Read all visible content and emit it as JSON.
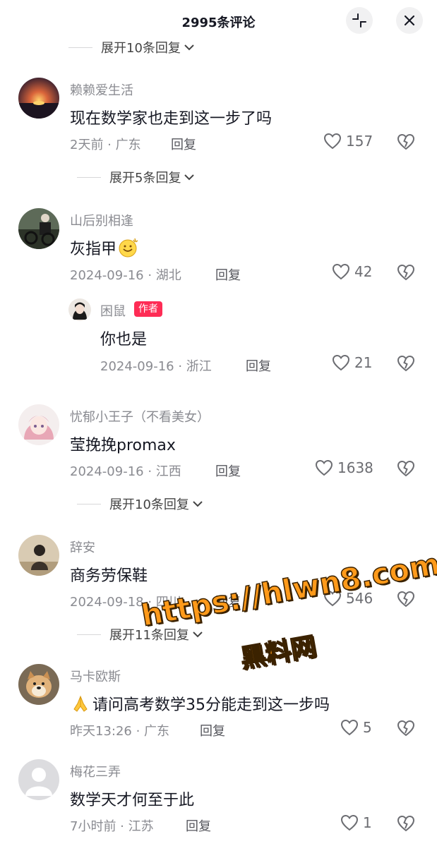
{
  "header": {
    "title": "2995条评论",
    "collapse_icon": "collapse-icon",
    "close_icon": "close-icon"
  },
  "top_expand": "展开10条回复",
  "comments": [
    {
      "user": "赖赖爱生活",
      "text": "现在数学家也走到这一步了吗",
      "meta": "2天前 · 广东",
      "reply": "回复",
      "likes": "157",
      "expand": "展开5条回复"
    },
    {
      "user": "山后别相逢",
      "text": "灰指甲",
      "meta": "2024-09-16 · 湖北",
      "reply": "回复",
      "likes": "42",
      "sub": {
        "user": "困鼠",
        "badge": "作者",
        "text": "你也是",
        "meta": "2024-09-16 · 浙江",
        "reply": "回复",
        "likes": "21"
      }
    },
    {
      "user": "忧郁小王子（不看美女）",
      "text": "莹挽挽promax",
      "meta": "2024-09-16 · 江西",
      "reply": "回复",
      "likes": "1638",
      "expand": "展开10条回复"
    },
    {
      "user": "辞安",
      "text": "商务劳保鞋",
      "meta": "2024-09-18 · 四川",
      "reply": "回复",
      "likes": "546",
      "expand": "展开11条回复"
    },
    {
      "user": "马卡欧斯",
      "text": "请问高考数学35分能走到这一步吗",
      "meta": "昨天13:26 · 广东",
      "reply": "回复",
      "likes": "5"
    },
    {
      "user": "梅花三弄",
      "text": "数学天才何至于此",
      "meta": "7小时前 · 江苏",
      "reply": "回复",
      "likes": "1"
    }
  ],
  "watermark": {
    "url": "https://hlwn8.com",
    "name": "黑料网"
  },
  "colors": {
    "accent": "#fe2c55",
    "watermark_fill": "#ff9a1a"
  }
}
